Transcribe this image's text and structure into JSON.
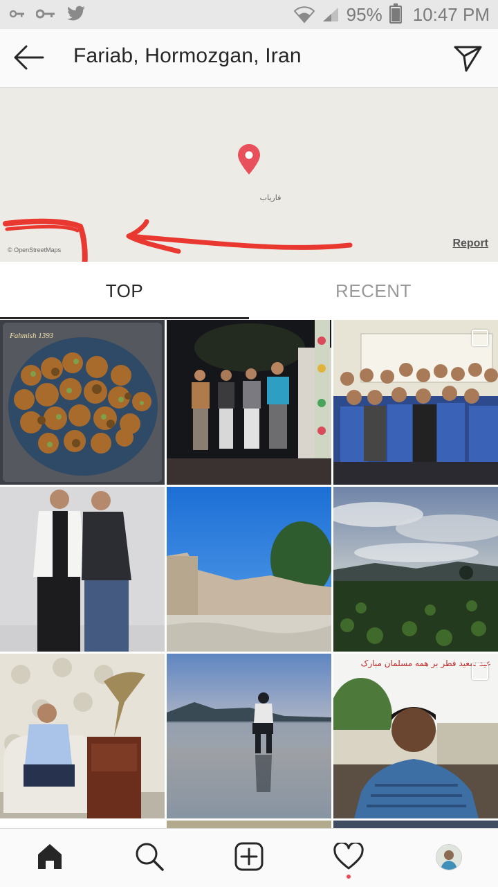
{
  "status_bar": {
    "battery": "95%",
    "time": "10:47 PM",
    "left_icons": [
      "key-icon",
      "key-icon",
      "twitter-icon"
    ],
    "right_icons": [
      "wifi-icon",
      "signal-icon",
      "battery-icon"
    ]
  },
  "header": {
    "title": "Fariab, Hormozgan, Iran",
    "back_icon": "arrow-left-icon",
    "share_icon": "paper-plane-icon"
  },
  "map": {
    "place_label": "فاریاب",
    "attribution": "© OpenStreetMaps",
    "report_label": "Report",
    "pin_color": "#e8505b",
    "annotation_color": "#e8382f"
  },
  "tabs": [
    {
      "label": "TOP",
      "selected": true
    },
    {
      "label": "RECENT",
      "selected": false
    }
  ],
  "grid": {
    "posts": [
      {
        "description": "food-photo",
        "multi": false,
        "overlay_text": "Fahmish 1393"
      },
      {
        "description": "group-night-photo",
        "multi": false
      },
      {
        "description": "classroom-group-photo",
        "multi": true
      },
      {
        "description": "two-men-photo",
        "multi": false
      },
      {
        "description": "ruins-blue-sky-photo",
        "multi": false
      },
      {
        "description": "sunset-field-photo",
        "multi": false
      },
      {
        "description": "man-with-gramophone-photo",
        "multi": false
      },
      {
        "description": "man-in-water-photo",
        "multi": false
      },
      {
        "description": "boy-selfie-photo",
        "multi": true,
        "overlay_text": "عید سعید فطر بر همه مسلمان مبارک"
      }
    ]
  },
  "bottom_nav": {
    "items": [
      "home-icon",
      "search-icon",
      "add-icon",
      "heart-icon",
      "profile-avatar"
    ],
    "active": "home-icon",
    "notification_dot_color": "#ed4956"
  }
}
